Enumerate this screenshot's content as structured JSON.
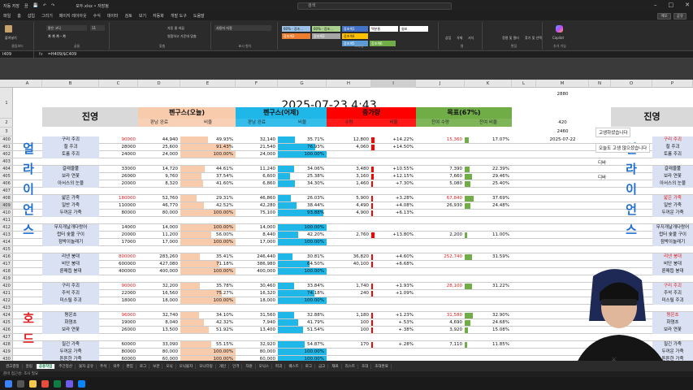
{
  "titlebar": {
    "autosave": "자동 저장",
    "autosave_state": "끔",
    "filename": "모두.xlsx • 저장됨",
    "search": "검색"
  },
  "menu": [
    "파일",
    "홈",
    "삽입",
    "그리기",
    "페이지 레이아웃",
    "수식",
    "데이터",
    "검토",
    "보기",
    "자동화",
    "개발 도구",
    "도움말"
  ],
  "menu_right": [
    "메모",
    "공유"
  ],
  "ribbon": {
    "groups": [
      "클립보드",
      "글꼴",
      "맞춤",
      "표시 형식",
      "스타일",
      "셀",
      "편집",
      "추가 기능"
    ],
    "font_name": "맑은 고딕",
    "font_size": "11",
    "number_format": "사용자 지정",
    "styles": [
      "60% - 강조...",
      "60% - 강조...",
      "강조색1",
      "강조색2",
      "강조색3",
      "강조색4",
      "강조색5",
      "강조색6",
      "백분율",
      "쉼표"
    ],
    "buttons": [
      "붙여넣기",
      "자동 줄 바꿈",
      "병합하고 가운데 맞춤",
      "조건부 서식",
      "표 서식",
      "셀 스타일",
      "삽입",
      "삭제",
      "서식",
      "정렬 및 필터",
      "찾기 및 선택",
      "Copilot"
    ]
  },
  "formula": {
    "namebox": "I409",
    "fx": "fx",
    "text": "=H409/$C409"
  },
  "columns": [
    "A",
    "B",
    "C",
    "D",
    "E",
    "F",
    "G",
    "H",
    "I",
    "J",
    "K",
    "L",
    "M",
    "N",
    "O",
    "P"
  ],
  "top": {
    "date": "2025-07-23 4:43",
    "m1": "2880",
    "m2": "420",
    "m3": "2460",
    "m4": "2025-07-22",
    "title_left": "진영",
    "title_right": "진영",
    "h_today": "펜구스(오늘)",
    "h_yest": "펜구스(어제)",
    "h_delta": "증가량",
    "h_goal": "목표(67%)",
    "sub": [
      "판남 완료",
      "비율",
      "판남 완료",
      "비율",
      "수량",
      "비율",
      "잔여 수량",
      "잔여 비율"
    ]
  },
  "rows": [
    "1",
    "2",
    "3",
    "400",
    "401",
    "402",
    "403",
    "404",
    "405",
    "406",
    "407",
    "408",
    "409",
    "410",
    "411",
    "412",
    "413",
    "414",
    "415",
    "416",
    "417",
    "418",
    "419",
    "420",
    "421",
    "422",
    "423",
    "424",
    "425",
    "426",
    "427",
    "428",
    "429",
    "430",
    "431",
    "432",
    "433",
    "434"
  ],
  "group1_label": [
    "얼",
    "라",
    "이",
    "언",
    "스"
  ],
  "group2_label": [
    "호",
    "드"
  ],
  "data": [
    [
      "구리 주괴",
      "90000",
      "44,940",
      "49.93%",
      "32,140",
      "35.71%",
      "12,800",
      "+14.22%",
      "15,360",
      "17.07%"
    ],
    [
      "철 주괴",
      "28000",
      "25,600",
      "91.43%",
      "21,540",
      "76.93%",
      "4,060",
      "+14.50%",
      "",
      ""
    ],
    [
      "토륨 주괴",
      "24000",
      "24,000",
      "100.00%",
      "24,000",
      "100.00%",
      "",
      "",
      "",
      ""
    ],
    [
      "",
      "",
      "",
      "",
      "",
      "",
      "",
      "",
      "",
      ""
    ],
    [
      "갈래물풀",
      "33000",
      "14,720",
      "44.61%",
      "11,240",
      "34.06%",
      "3,480",
      "+10.55%",
      "7,390",
      "22.39%"
    ],
    [
      "보라 연꽃",
      "26000",
      "9,760",
      "37.54%",
      "6,600",
      "25.38%",
      "3,160",
      "+12.15%",
      "7,660",
      "29.46%"
    ],
    [
      "아서스의 눈물",
      "20000",
      "8,320",
      "41.60%",
      "6,860",
      "34.30%",
      "1,460",
      "+7.30%",
      "5,080",
      "25.40%"
    ],
    [
      "",
      "",
      "",
      "",
      "",
      "",
      "",
      "",
      "",
      ""
    ],
    [
      "얇은 가죽",
      "180000",
      "52,760",
      "29.31%",
      "46,860",
      "26.03%",
      "5,900",
      "+3.28%",
      "67,840",
      "37.69%"
    ],
    [
      "일반 가죽",
      "110000",
      "46,770",
      "42.52%",
      "42,280",
      "38.44%",
      "4,490",
      "+4.08%",
      "26,930",
      "24.48%"
    ],
    [
      "두꺼운 가죽",
      "80000",
      "80,000",
      "100.00%",
      "75,100",
      "93.88%",
      "4,900",
      "+6.13%",
      "",
      ""
    ],
    [
      "",
      "",
      "",
      "",
      "",
      "",
      "",
      "",
      "",
      ""
    ],
    [
      "무지개날개다랑어",
      "14000",
      "14,000",
      "100.00%",
      "14,000",
      "100.00%",
      "",
      "",
      "",
      ""
    ],
    [
      "럽터 숯불 구이",
      "20000",
      "11,200",
      "56.00%",
      "8,440",
      "42.20%",
      "2,760",
      "+13.80%",
      "2,200",
      "11.00%"
    ],
    [
      "점박이놀래기",
      "17000",
      "17,000",
      "100.00%",
      "17,000",
      "100.00%",
      "",
      "",
      "",
      ""
    ],
    [
      "",
      "",
      "",
      "",
      "",
      "",
      "",
      "",
      "",
      ""
    ],
    [
      "리넨 붕대",
      "800000",
      "283,260",
      "35.41%",
      "246,440",
      "30.81%",
      "36,820",
      "+4.60%",
      "252,740",
      "31.59%"
    ],
    [
      "비단 붕대",
      "600000",
      "427,080",
      "71.18%",
      "386,980",
      "64.50%",
      "40,100",
      "+6.68%",
      "",
      ""
    ],
    [
      "룬매듭 붕대",
      "400000",
      "400,000",
      "100.00%",
      "400,000",
      "100.00%",
      "",
      "",
      "",
      ""
    ],
    [
      "",
      "",
      "",
      "",
      "",
      "",
      "",
      "",
      "",
      ""
    ],
    [
      "구리 주괴",
      "90000",
      "32,200",
      "35.78%",
      "30,460",
      "33.84%",
      "1,740",
      "+1.93%",
      "28,100",
      "31.22%"
    ],
    [
      "주석 주괴",
      "22000",
      "16,560",
      "75.27%",
      "16,320",
      "74.18%",
      "240",
      "+1.09%",
      "",
      ""
    ],
    [
      "미스릴 주괴",
      "18000",
      "18,000",
      "100.00%",
      "18,000",
      "100.00%",
      "",
      "",
      "",
      ""
    ],
    [
      "",
      "",
      "",
      "",
      "",
      "",
      "",
      "",
      "",
      ""
    ],
    [
      "평온초",
      "96000",
      "32,740",
      "34.10%",
      "31,560",
      "32.88%",
      "1,180",
      "+1.23%",
      "31,580",
      "32.90%"
    ],
    [
      "화염초",
      "19000",
      "8,040",
      "42.32%",
      "7,940",
      "41.79%",
      "100",
      "+.53%",
      "4,690",
      "24.68%"
    ],
    [
      "보라 연꽃",
      "26000",
      "13,500",
      "51.92%",
      "13,400",
      "51.54%",
      "100",
      "+.38%",
      "3,920",
      "15.08%"
    ],
    [
      "",
      "",
      "",
      "",
      "",
      "",
      "",
      "",
      "",
      ""
    ],
    [
      "질긴 가죽",
      "60000",
      "33,090",
      "55.15%",
      "32,920",
      "54.87%",
      "170",
      "+.28%",
      "7,110",
      "11.85%"
    ],
    [
      "두꺼운 가죽",
      "80000",
      "80,000",
      "100.00%",
      "80,000",
      "100.00%",
      "",
      "",
      "",
      ""
    ],
    [
      "튼튼한 가죽",
      "60000",
      "60,000",
      "100.00%",
      "60,000",
      "100.00%",
      "",
      "",
      "",
      ""
    ],
    [
      "",
      "",
      "",
      "",
      "",
      "",
      "",
      "",
      "",
      ""
    ],
    [
      "녹대 살코기",
      "10000",
      "4,580",
      "45.80%",
      "4,400",
      "44.00%",
      "180",
      "+1.80%",
      "2,120",
      "21.20%"
    ],
    [
      "점박이놀래기",
      "17000",
      "17,000",
      "100.00%",
      "17,000",
      "100.00%",
      "",
      "",
      "",
      ""
    ],
    [
      "흑해 역어",
      "10000",
      "4,660",
      "46.60%",
      "4,660",
      "46.60%",
      "",
      "+.0%",
      "2,040",
      "20.40%"
    ]
  ],
  "right_col": [
    "구리 주괴",
    "철 주괴",
    "토륨 주괴",
    "",
    "갈래물풀",
    "보라 연꽃",
    "아서스의 눈물",
    "",
    "얇은 가죽",
    "일반 가죽",
    "두꺼운 가죽",
    "",
    "무지개날개다랑어",
    "럽터 숯불 구이",
    "점박이놀래기",
    "",
    "리넨 붕대",
    "비단 붕대",
    "룬매듭 붕대",
    "",
    "구리 주괴",
    "주석 주괴",
    "미스릴 주괴",
    "",
    "평온초",
    "화염초",
    "보라 연꽃",
    "",
    "질긴 가죽",
    "두꺼운 가죽",
    "튼튼한 가죽",
    "",
    "녹대 살코기",
    "점박이놀래기",
    "흑해 역어"
  ],
  "popups": [
    "고생하셨습니다",
    "오늘도 고생 많으셨습니다",
    "디바",
    "디바"
  ],
  "tabs": [
    "권고결정",
    "알림",
    "공용작업",
    "주간정산",
    "물자 공유",
    "주석",
    "의주",
    "편집",
    "로그",
    "보관",
    "오닉",
    "오닉물자",
    "모니터링",
    "개인",
    "인격",
    "자원",
    "오닉스",
    "파괴",
    "퀘스트",
    "로그",
    "금고",
    "재료",
    "리스트",
    "초대",
    "초대완료"
  ],
  "active_tab": "공용작업",
  "status": "준비  접근성: 조사 필요",
  "colors": {
    "peach": "#f8cbad",
    "cyan": "#1fb6e8",
    "red": "#ff0000",
    "green": "#70ad47",
    "gray": "#d9d9d9",
    "bluelabel": "#1f6fd0",
    "redlabel": "#e02020"
  }
}
